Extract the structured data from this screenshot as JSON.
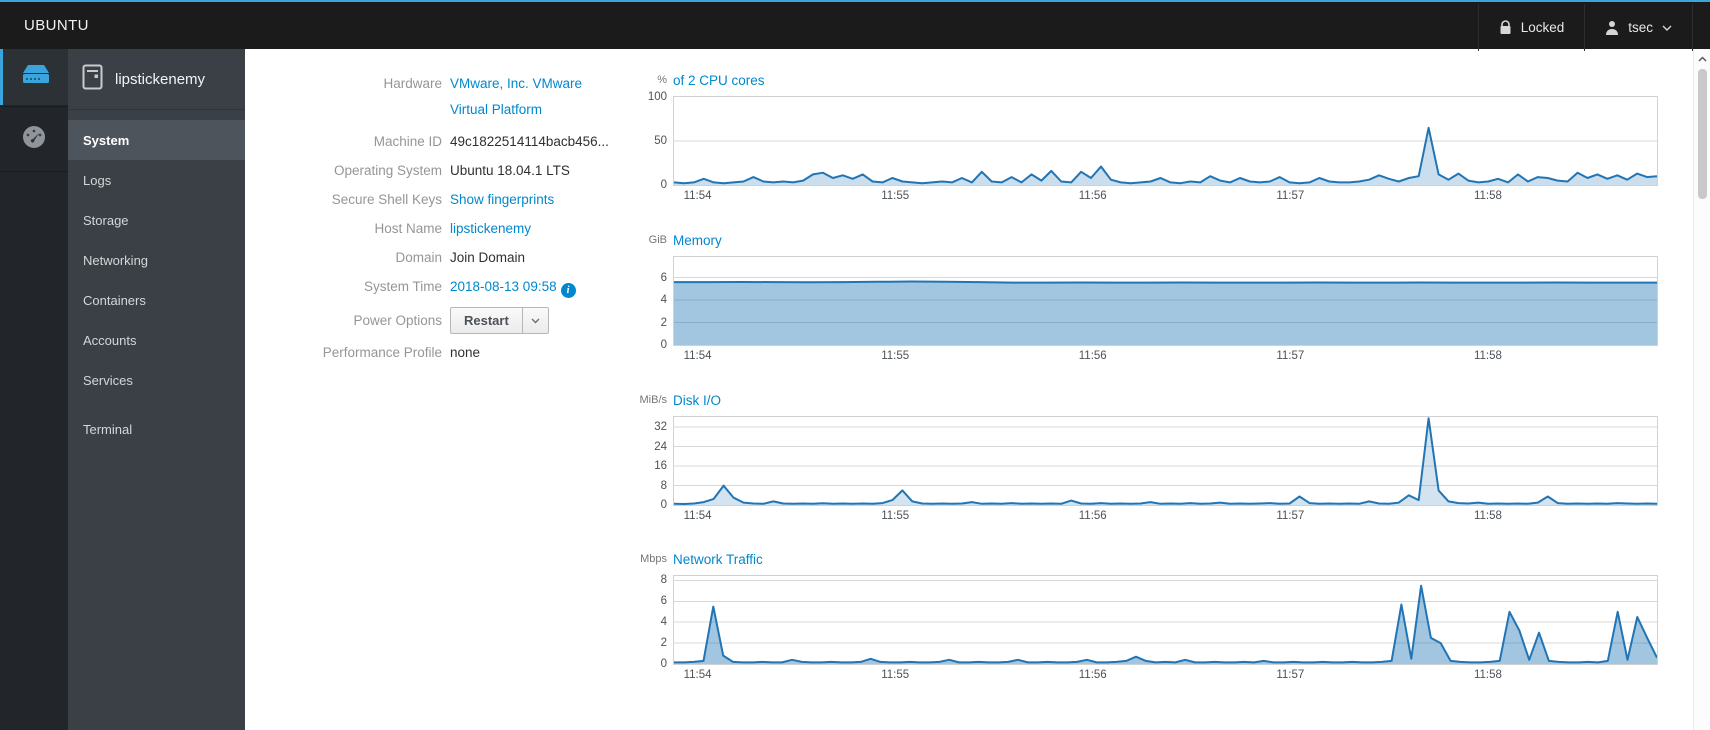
{
  "topbar": {
    "brand": "UBUNTU",
    "locked_label": "Locked",
    "user": "tsec"
  },
  "sidebar": {
    "host": "lipstickenemy",
    "items": [
      {
        "label": "System"
      },
      {
        "label": "Logs"
      },
      {
        "label": "Storage"
      },
      {
        "label": "Networking"
      },
      {
        "label": "Containers"
      },
      {
        "label": "Accounts"
      },
      {
        "label": "Services"
      },
      {
        "label": "Terminal"
      }
    ]
  },
  "info": {
    "hardware_label": "Hardware",
    "hardware_value_line1": "VMware, Inc. VMware",
    "hardware_value_line2": "Virtual Platform",
    "machine_id_label": "Machine ID",
    "machine_id_value": "49c1822514114bacb456...",
    "os_label": "Operating System",
    "os_value": "Ubuntu 18.04.1 LTS",
    "ssh_label": "Secure Shell Keys",
    "ssh_value": "Show fingerprints",
    "hostname_label": "Host Name",
    "hostname_value": "lipstickenemy",
    "domain_label": "Domain",
    "domain_value": "Join Domain",
    "time_label": "System Time",
    "time_value": "2018-08-13 09:58",
    "power_label": "Power Options",
    "power_button": "Restart",
    "profile_label": "Performance Profile",
    "profile_value": "none"
  },
  "colors": {
    "accent_blue": "#39a5dc",
    "link_blue": "#0088ce",
    "chart_line": "#2175b5"
  },
  "chart_data": [
    {
      "type": "area",
      "unit": "%",
      "title": "of 2 CPU cores",
      "ylim": [
        0,
        100
      ],
      "yticks": [
        0,
        50,
        100
      ],
      "ymax_top": 100,
      "grid": true,
      "x_tick_labels": [
        "11:54",
        "11:55",
        "11:56",
        "11:57",
        "11:58"
      ],
      "x_tick_fracs": [
        0.025,
        0.226,
        0.427,
        0.628,
        0.829
      ],
      "line_color": "#2175b5",
      "fill_color": "rgba(33,117,181,0.24)",
      "values": [
        3,
        2,
        3,
        7,
        3,
        2,
        3,
        4,
        9,
        4,
        3,
        4,
        3,
        5,
        12,
        14,
        8,
        11,
        7,
        12,
        4,
        3,
        8,
        4,
        3,
        2,
        3,
        4,
        3,
        8,
        3,
        15,
        4,
        3,
        9,
        3,
        12,
        5,
        16,
        4,
        3,
        15,
        8,
        21,
        6,
        3,
        2,
        3,
        4,
        8,
        3,
        2,
        4,
        3,
        10,
        5,
        3,
        8,
        4,
        3,
        4,
        9,
        3,
        2,
        3,
        8,
        4,
        3,
        3,
        4,
        6,
        11,
        7,
        4,
        8,
        10,
        65,
        12,
        6,
        13,
        5,
        3,
        4,
        7,
        3,
        12,
        4,
        9,
        8,
        5,
        4,
        14,
        8,
        12,
        7,
        11,
        6,
        13,
        9,
        10
      ]
    },
    {
      "type": "area",
      "unit": "GiB",
      "title": "Memory",
      "ylim": [
        0,
        7.83
      ],
      "yticks": [
        0,
        2,
        4,
        6
      ],
      "ymax_top": 7.83,
      "grid": true,
      "x_tick_labels": [
        "11:54",
        "11:55",
        "11:56",
        "11:57",
        "11:58"
      ],
      "x_tick_fracs": [
        0.025,
        0.226,
        0.427,
        0.628,
        0.829
      ],
      "line_color": "#2175b5",
      "fill_color": "rgba(33,117,181,0.42)",
      "values": [
        5.6,
        5.6,
        5.61,
        5.6,
        5.59,
        5.6,
        5.62,
        5.65,
        5.63,
        5.6,
        5.55,
        5.55,
        5.56,
        5.55,
        5.55,
        5.56,
        5.55,
        5.55,
        5.55,
        5.56,
        5.55,
        5.55,
        5.56,
        5.55,
        5.55,
        5.55,
        5.56,
        5.55,
        5.55,
        5.55
      ]
    },
    {
      "type": "area",
      "unit": "MiB/s",
      "title": "Disk I/O",
      "ylim": [
        0,
        36.2
      ],
      "yticks": [
        0,
        8,
        16,
        24,
        32
      ],
      "ymax_top": 36.2,
      "grid": true,
      "x_tick_labels": [
        "11:54",
        "11:55",
        "11:56",
        "11:57",
        "11:58"
      ],
      "x_tick_fracs": [
        0.025,
        0.226,
        0.427,
        0.628,
        0.829
      ],
      "line_color": "#2175b5",
      "fill_color": "rgba(33,117,181,0.2)",
      "values": [
        0.5,
        0.4,
        0.6,
        1.2,
        2.5,
        8,
        3,
        1,
        0.6,
        0.5,
        1.5,
        0.6,
        0.5,
        0.6,
        0.5,
        0.7,
        0.5,
        0.6,
        0.5,
        0.6,
        0.5,
        0.8,
        2,
        6,
        1.5,
        0.6,
        0.5,
        0.6,
        0.5,
        0.6,
        1.2,
        0.5,
        0.6,
        0.5,
        0.8,
        0.5,
        0.6,
        0.5,
        0.6,
        0.5,
        1.8,
        0.6,
        0.5,
        0.8,
        0.5,
        0.6,
        0.5,
        0.6,
        1.2,
        0.5,
        0.6,
        0.5,
        0.8,
        0.5,
        0.6,
        1,
        0.5,
        0.6,
        0.5,
        0.6,
        0.8,
        0.5,
        0.6,
        3.5,
        0.8,
        0.5,
        0.6,
        0.5,
        0.6,
        0.5,
        1.5,
        0.6,
        0.5,
        1,
        4,
        2,
        36,
        6,
        1.5,
        0.8,
        0.6,
        1,
        0.5,
        0.6,
        0.5,
        0.6,
        0.5,
        1,
        3.5,
        0.8,
        0.5,
        0.6,
        0.5,
        0.6,
        0.5,
        0.8,
        0.6,
        0.5,
        0.6,
        0.5
      ]
    },
    {
      "type": "area",
      "unit": "Mbps",
      "title": "Network Traffic",
      "ylim": [
        0,
        8.43
      ],
      "yticks": [
        0,
        2,
        4,
        6,
        8
      ],
      "ymax_top": 8.43,
      "grid": true,
      "x_tick_labels": [
        "11:54",
        "11:55",
        "11:56",
        "11:57",
        "11:58"
      ],
      "x_tick_fracs": [
        0.025,
        0.226,
        0.427,
        0.628,
        0.829
      ],
      "line_color": "#2175b5",
      "fill_color": "rgba(33,117,181,0.42)",
      "values": [
        0.15,
        0.15,
        0.2,
        0.3,
        5.5,
        0.8,
        0.2,
        0.15,
        0.15,
        0.2,
        0.15,
        0.15,
        0.4,
        0.2,
        0.15,
        0.15,
        0.2,
        0.15,
        0.15,
        0.2,
        0.5,
        0.2,
        0.15,
        0.15,
        0.2,
        0.15,
        0.15,
        0.2,
        0.4,
        0.15,
        0.15,
        0.2,
        0.15,
        0.15,
        0.2,
        0.4,
        0.15,
        0.15,
        0.2,
        0.15,
        0.15,
        0.2,
        0.4,
        0.15,
        0.15,
        0.2,
        0.3,
        0.7,
        0.3,
        0.15,
        0.2,
        0.15,
        0.4,
        0.15,
        0.15,
        0.2,
        0.15,
        0.15,
        0.2,
        0.15,
        0.3,
        0.15,
        0.15,
        0.2,
        0.15,
        0.15,
        0.2,
        0.15,
        0.15,
        0.2,
        0.15,
        0.15,
        0.2,
        0.3,
        5.7,
        0.5,
        7.5,
        2.5,
        2,
        0.3,
        0.2,
        0.15,
        0.15,
        0.2,
        0.3,
        5,
        3.2,
        0.4,
        3,
        0.3,
        0.2,
        0.15,
        0.15,
        0.2,
        0.15,
        0.3,
        5,
        0.4,
        4.5,
        2.5,
        0.6
      ]
    }
  ]
}
